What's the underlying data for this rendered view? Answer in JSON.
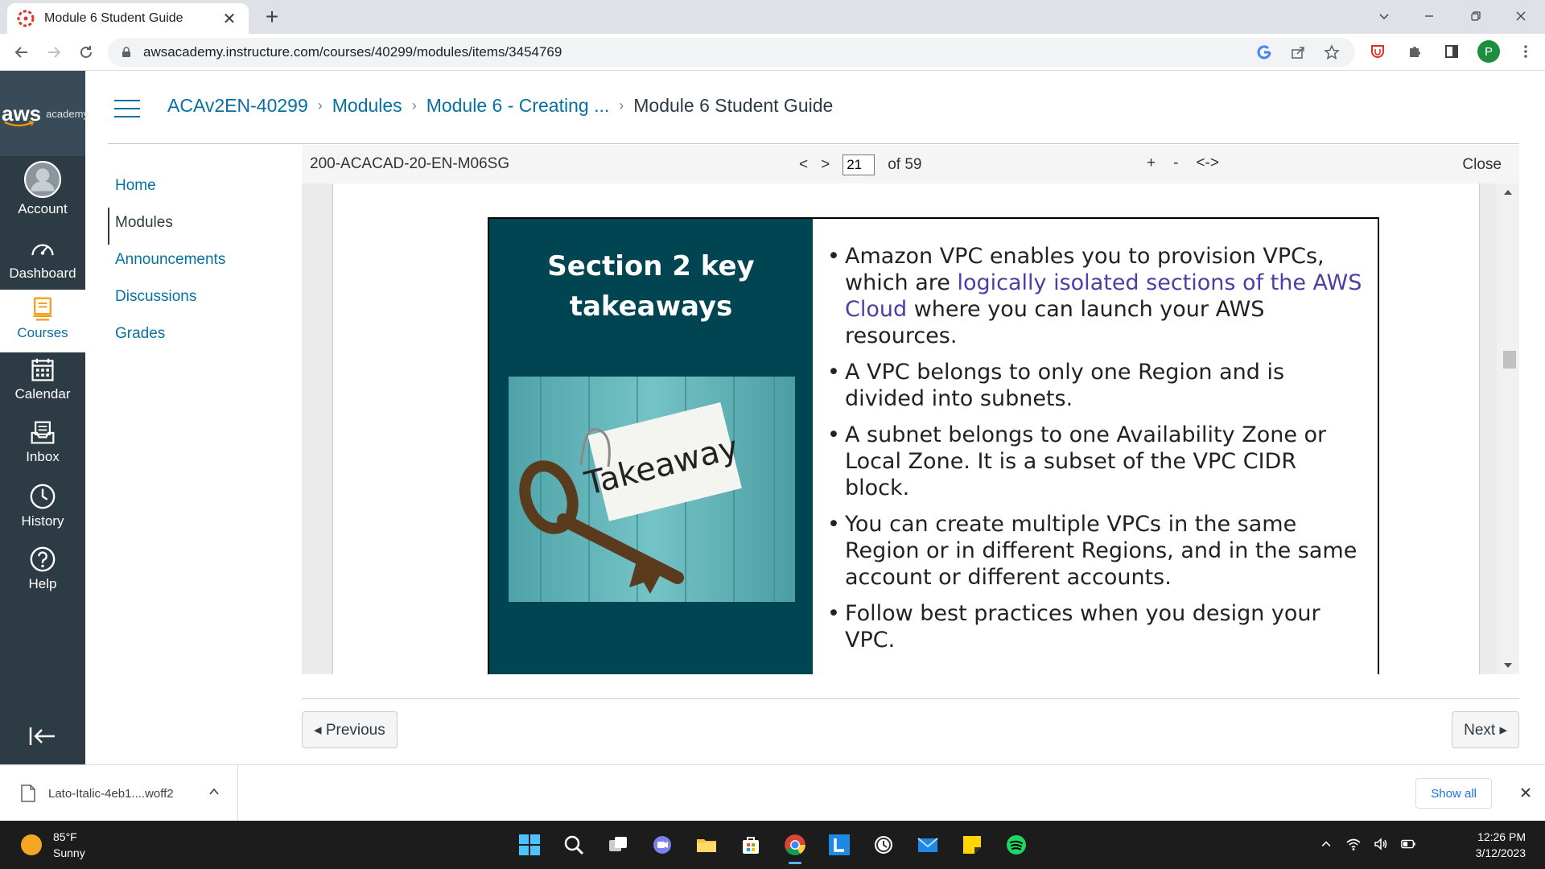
{
  "browser": {
    "tab_title": "Module 6 Student Guide",
    "url": "awsacademy.instructure.com/courses/40299/modules/items/3454769",
    "profile_initial": "P"
  },
  "global_nav": {
    "logo_text": "aws",
    "logo_sub": "academy",
    "items": [
      {
        "label": "Account",
        "icon": "account-icon"
      },
      {
        "label": "Dashboard",
        "icon": "dashboard-icon"
      },
      {
        "label": "Courses",
        "icon": "courses-icon",
        "active": true
      },
      {
        "label": "Calendar",
        "icon": "calendar-icon"
      },
      {
        "label": "Inbox",
        "icon": "inbox-icon"
      },
      {
        "label": "History",
        "icon": "history-icon"
      },
      {
        "label": "Help",
        "icon": "help-icon"
      }
    ]
  },
  "breadcrumb": [
    {
      "label": "ACAv2EN-40299"
    },
    {
      "label": "Modules"
    },
    {
      "label": "Module 6 - Creating ..."
    },
    {
      "label": "Module 6 Student Guide"
    }
  ],
  "course_nav": [
    {
      "label": "Home"
    },
    {
      "label": "Modules",
      "active": true
    },
    {
      "label": "Announcements"
    },
    {
      "label": "Discussions"
    },
    {
      "label": "Grades"
    }
  ],
  "viewer": {
    "doc_id": "200-ACACAD-20-EN-M06SG",
    "prev": "<",
    "next": ">",
    "page": "21",
    "of_total": "of 59",
    "zoom_in": "+",
    "zoom_out": "-",
    "fit": "<->",
    "close": "Close"
  },
  "slide": {
    "title_line1": "Section 2 key",
    "title_line2": "takeaways",
    "image_label": "Takeaway",
    "bullets": [
      {
        "pre": "Amazon VPC enables you to provision VPCs, which are ",
        "hl": "logically isolated sections of the AWS Cloud",
        "post": " where you can launch your AWS resources."
      },
      {
        "pre": "A VPC belongs to only one Region and is divided into subnets.",
        "hl": "",
        "post": ""
      },
      {
        "pre": "A subnet belongs to one Availability Zone or Local Zone. It is a subset of the VPC CIDR block.",
        "hl": "",
        "post": ""
      },
      {
        "pre": "You can create multiple VPCs in the same Region or in different Regions, and in the same account or different accounts.",
        "hl": "",
        "post": ""
      },
      {
        "pre": "Follow best practices when you design your VPC.",
        "hl": "",
        "post": ""
      }
    ]
  },
  "footer": {
    "previous": "◂ Previous",
    "next": "Next ▸"
  },
  "download": {
    "filename": "Lato-Italic-4eb1....woff2",
    "show_all": "Show all"
  },
  "taskbar": {
    "temperature": "85°F",
    "condition": "Sunny",
    "time": "12:26 PM",
    "date": "3/12/2023"
  }
}
